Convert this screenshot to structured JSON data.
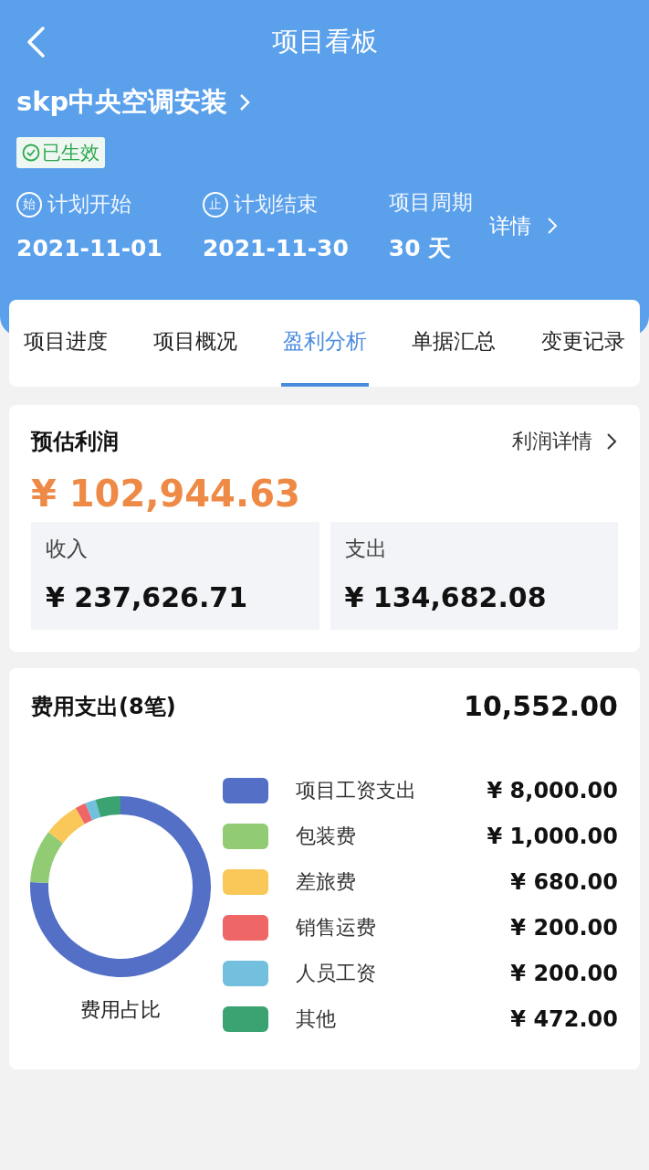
{
  "header": {
    "title": "项目看板"
  },
  "project": {
    "name": "skp中央空调安装",
    "status": "已生效"
  },
  "plan": [
    {
      "kind": "start",
      "label": "计划开始",
      "icon": "始",
      "value": "2021-11-01"
    },
    {
      "kind": "end",
      "label": "计划结束",
      "icon": "止",
      "value": "2021-11-30"
    },
    {
      "kind": "period",
      "label": "项目周期",
      "value": "30 天"
    }
  ],
  "details_link": "详情",
  "tabs": [
    {
      "label": "项目进度",
      "selected": false
    },
    {
      "label": "项目概况",
      "selected": false
    },
    {
      "label": "盈利分析",
      "selected": true
    },
    {
      "label": "单据汇总",
      "selected": false
    },
    {
      "label": "变更记录",
      "selected": false
    }
  ],
  "profit": {
    "title": "预估利润",
    "link": "利润详情",
    "amount": "¥ 102,944.63",
    "boxes": [
      {
        "label": "收入",
        "value": "¥ 237,626.71"
      },
      {
        "label": "支出",
        "value": "¥ 134,682.08"
      }
    ]
  },
  "expenses": {
    "title": "费用支出(8笔)",
    "total": "10,552.00",
    "legend": [
      {
        "name": "项目工资支出",
        "amount": "¥ 8,000.00",
        "color": "#5470c6"
      },
      {
        "name": "包装费",
        "amount": "¥ 1,000.00",
        "color": "#91cc75"
      },
      {
        "name": "差旅费",
        "amount": "¥ 680.00",
        "color": "#fac858"
      },
      {
        "name": "销售运费",
        "amount": "¥ 200.00",
        "color": "#ee6666"
      },
      {
        "name": "人员工资",
        "amount": "¥ 200.00",
        "color": "#73c0de"
      },
      {
        "name": "其他",
        "amount": "¥ 472.00",
        "color": "#3ba272"
      }
    ],
    "chart_title": "费用占比"
  }
}
